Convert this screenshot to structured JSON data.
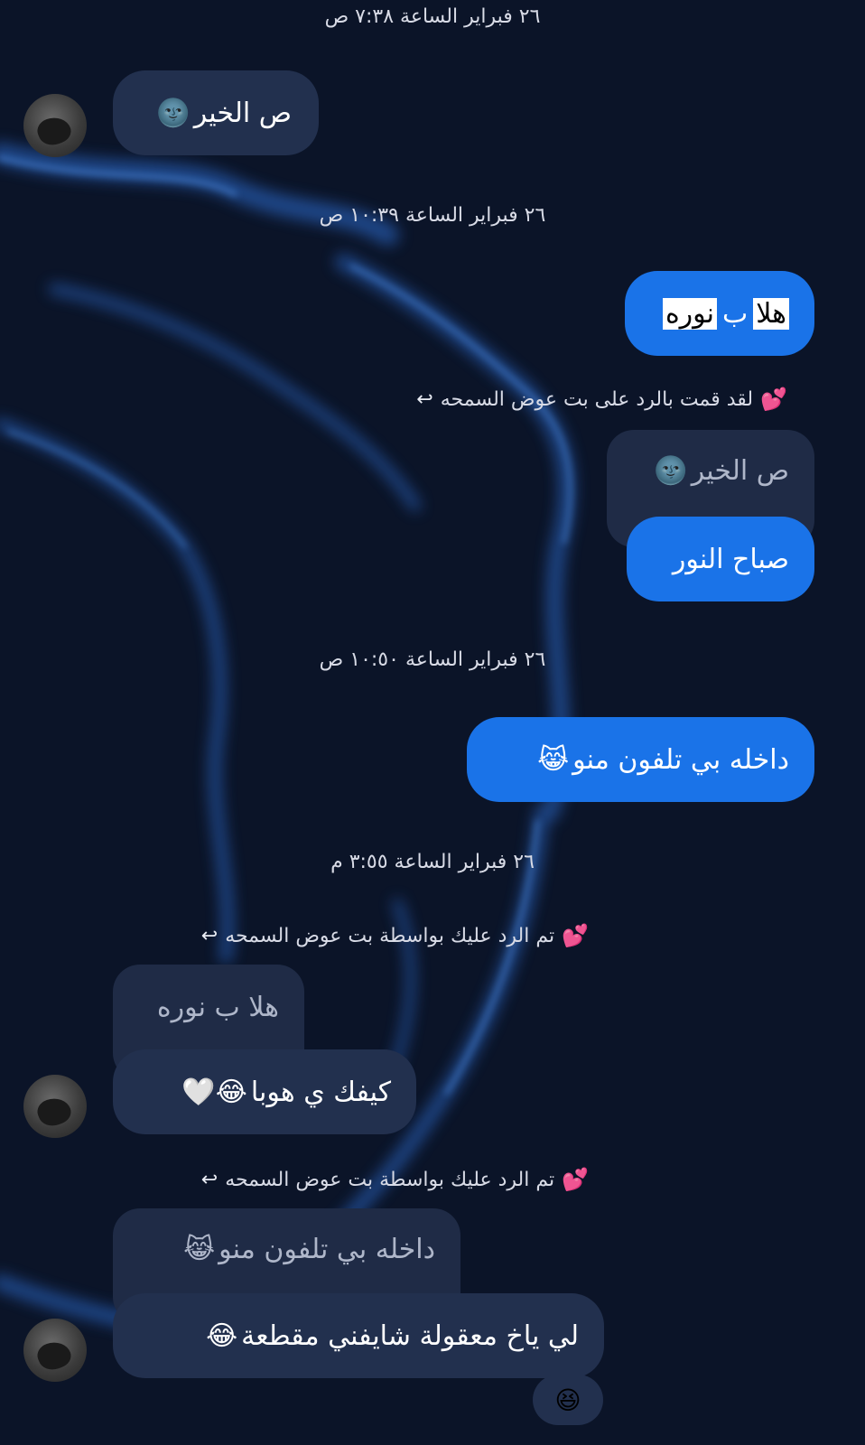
{
  "colors": {
    "background": "#0b1428",
    "incoming_bubble": "#22304e",
    "outgoing_bubble": "#1a73e8",
    "quote_bubble": "#1f2b46",
    "reply_heart": "#ff4f8b"
  },
  "timestamps": [
    "٢٦ فبراير الساعة ٧:٣٨ ص",
    "٢٦ فبراير الساعة ١٠:٣٩ ص",
    "٢٦ فبراير الساعة ١٠:٥٠ ص",
    "٢٦ فبراير الساعة ٣:٥٥ م"
  ],
  "messages": {
    "m1_text": "ص الخير",
    "m1_emoji": "🌚",
    "m2_word1": "هلا",
    "m2_word2": "ب",
    "m2_word3": "نوره",
    "reply_note_sent": "لقد قمت بالرد على بت عوض السمحه",
    "m3_quote_text": "ص الخير",
    "m3_quote_emoji": "🌚",
    "m3_text": "صباح النور",
    "m4_text": "داخله بي تلفون منو",
    "m4_emoji": "😹",
    "reply_note_received_1": "تم الرد عليك بواسطة بت عوض السمحه",
    "m5_quote_text": "هلا ب نوره",
    "m5_text": "كيفك ي هوبا",
    "m5_emoji": "😂🤍",
    "reply_note_received_2": "تم الرد عليك بواسطة بت عوض السمحه",
    "m6_quote_text": "داخله بي تلفون منو",
    "m6_quote_emoji": "😹",
    "m6_text": "لي ياخ معقولة شايفني مقطعة",
    "m6_emoji": "😂",
    "m6_reaction": "😆"
  },
  "icons": {
    "reply": "reply-arrow-icon",
    "heart": "two-hearts-icon",
    "avatar": "avatar"
  }
}
